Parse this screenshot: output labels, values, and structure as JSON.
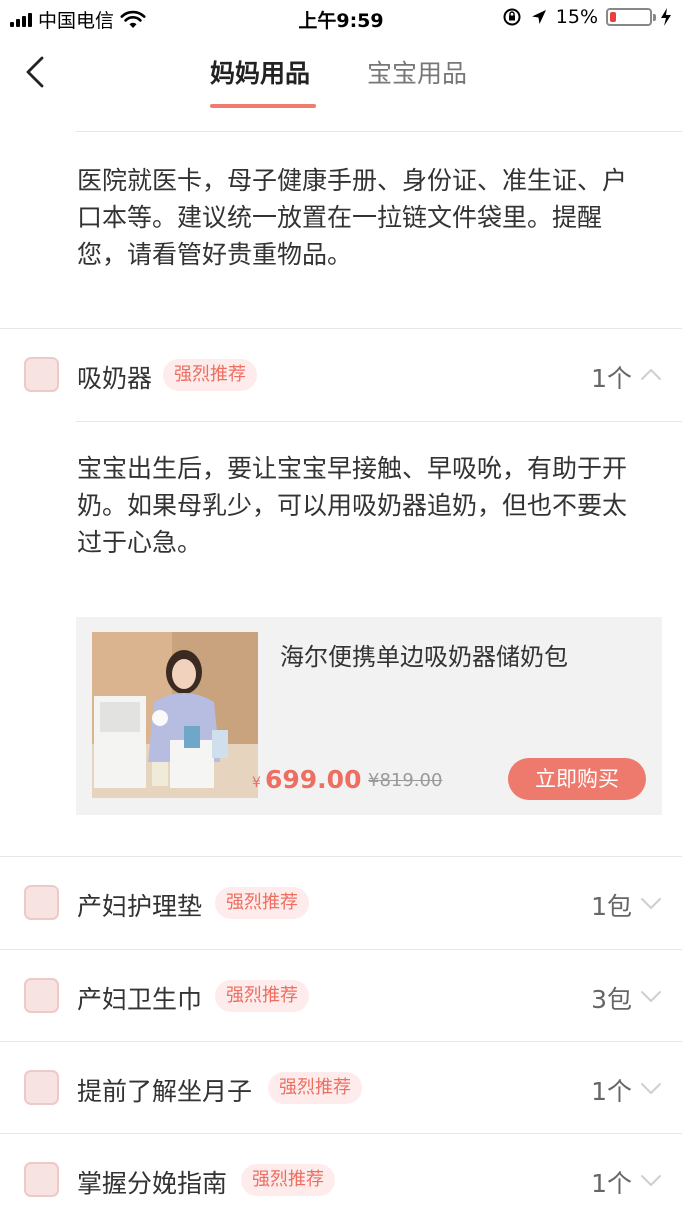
{
  "status_bar": {
    "carrier": "中国电信",
    "time": "上午9:59",
    "battery_percent": "15%",
    "battery_level": 0.15,
    "icons": [
      "signal-icon",
      "wifi-icon",
      "rotation-lock-icon",
      "location-icon",
      "battery-icon",
      "charging-icon"
    ]
  },
  "nav": {
    "back_icon": "chevron-left-icon",
    "tabs": [
      {
        "label": "妈妈用品",
        "active": true
      },
      {
        "label": "宝宝用品",
        "active": false
      }
    ]
  },
  "top_note": {
    "lines": [
      "医院就医卡，母子健康手册、身份证、准生证、户",
      "口本等。建议统一放置在一拉链文件袋里。提醒",
      "您，请看管好贵重物品。"
    ]
  },
  "items": [
    {
      "name": "吸奶器",
      "badge": "强烈推荐",
      "qty": "1个",
      "expanded": true
    },
    {
      "name": "产妇护理垫",
      "badge": "强烈推荐",
      "qty": "1包",
      "expanded": false
    },
    {
      "name": "产妇卫生巾",
      "badge": "强烈推荐",
      "qty": "3包",
      "expanded": false
    },
    {
      "name": "提前了解坐月子",
      "badge": "强烈推荐",
      "qty": "1个",
      "expanded": false
    },
    {
      "name": "掌握分娩指南",
      "badge": "强烈推荐",
      "qty": "1个",
      "expanded": false
    }
  ],
  "expanded_detail": {
    "lines": [
      "宝宝出生后，要让宝宝早接触、早吸吮，有助于开",
      "奶。如果母乳少，可以用吸奶器追奶，但也不要太",
      "过于心急。"
    ],
    "product": {
      "title": "海尔便携单边吸奶器储奶包",
      "currency": "¥",
      "price": "699.00",
      "original_price": "¥819.00",
      "buy_label": "立即购买"
    }
  },
  "colors": {
    "accent": "#ee7a6d",
    "badge_bg": "#fdeceb",
    "checkbox_fill": "#f7e3e2",
    "divider": "#e6e6e6"
  }
}
